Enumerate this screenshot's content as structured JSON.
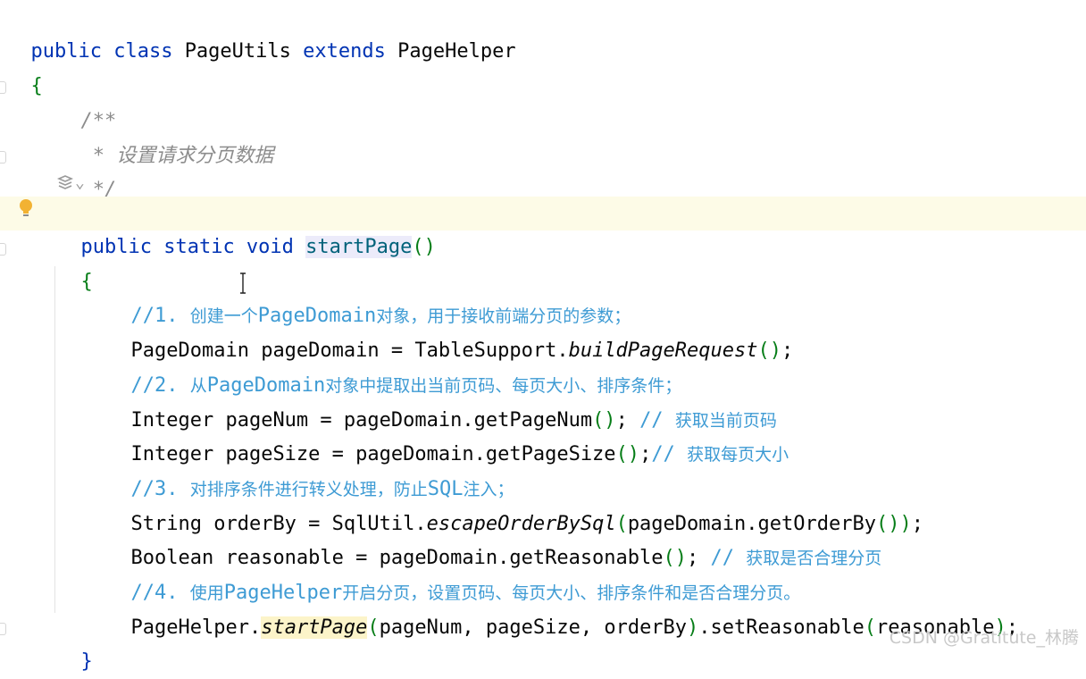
{
  "editor": {
    "line1": {
      "kw": "public class ",
      "name": "PageUtils ",
      "kw2": "extends ",
      "parent": "PageHelper"
    },
    "line2": {
      "brace": "{"
    },
    "doc": {
      "open": "/**",
      "desc": " * 设置请求分页数据",
      "close": " */"
    },
    "inlay": {
      "icon": "ai-assistant-icon",
      "chevron": "⌄"
    },
    "method": {
      "kw": "public static void ",
      "name": "startPage",
      "parens": "()"
    },
    "method_open": "{",
    "c1": {
      "slashes": "//1. ",
      "a": "创建一个",
      "b": "PageDomain",
      "c": "对象，用于接收前端分页的参数；"
    },
    "s1": {
      "a": "PageDomain pageDomain = TableSupport.",
      "b": "buildPageRequest",
      "c": "()",
      "d": ";"
    },
    "c2": {
      "slashes": "//2. ",
      "a": "从",
      "b": "PageDomain",
      "c": "对象中提取出当前页码、每页大小、排序条件；"
    },
    "s2": {
      "a": "Integer pageNum = pageDomain.getPageNum",
      "b": "()",
      "c": "; ",
      "d": "// ",
      "e": "获取当前页码"
    },
    "s3": {
      "a": "Integer pageSize = pageDomain.getPageSize",
      "b": "()",
      "c": ";",
      "d": "// ",
      "e": "获取每页大小"
    },
    "c3": {
      "slashes": "//3. ",
      "a": "对排序条件进行转义处理，防止",
      "b": "SQL",
      "c": "注入；"
    },
    "s4": {
      "a": "String orderBy = SqlUtil.",
      "b": "escapeOrderBySql",
      "c": "(",
      "d": "pageDomain.getOrderBy",
      "e": "()",
      "f": ")",
      "g": ";"
    },
    "s5": {
      "a": "Boolean reasonable = pageDomain.getReasonable",
      "b": "()",
      "c": "; ",
      "d": "// ",
      "e": "获取是否合理分页"
    },
    "c4": {
      "slashes": "//4. ",
      "a": "使用",
      "b": "PageHelper",
      "c": "开启分页，设置页码、每页大小、排序条件和是否合理分页。"
    },
    "s6": {
      "a": "PageHelper.",
      "b": "startPage",
      "c": "(",
      "d": "pageNum, pageSize, orderBy",
      "e": ")",
      "f": ".setReasonable",
      "g": "(",
      "h": "reasonable",
      "i": ")",
      "j": ";"
    },
    "method_close": "}"
  },
  "gutter": {
    "bulb_icon": "lightbulb-icon",
    "fold_icon": "fold-marker-icon"
  },
  "colors": {
    "keyword": "#0033b3",
    "method_decl": "#00627a",
    "brace": "#067d17",
    "doc": "#8c8c8c",
    "comment": "#3e9bd4",
    "current_line": "#fdfbe7"
  },
  "watermark": "CSDN @Gratitute_林腾"
}
